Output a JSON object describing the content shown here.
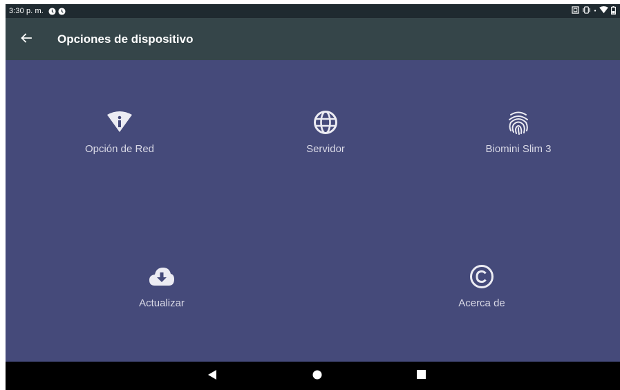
{
  "status_bar": {
    "time": "3:30 p. m.",
    "left_icons": [
      "clock-icon",
      "clock-icon"
    ],
    "right_icons": [
      "screenshot-icon",
      "vibrate-icon",
      "wifi-icon",
      "battery-icon"
    ]
  },
  "app_bar": {
    "back_icon": "arrow-left-icon",
    "title": "Opciones de dispositivo",
    "color": "#354549"
  },
  "content": {
    "background": "#454a7a",
    "tiles": [
      {
        "id": "network",
        "label": "Opción de Red",
        "icon": "wifi-info-icon"
      },
      {
        "id": "server",
        "label": "Servidor",
        "icon": "globe-icon"
      },
      {
        "id": "biomini",
        "label": "Biomini Slim 3",
        "icon": "fingerprint-icon"
      },
      {
        "id": "update",
        "label": "Actualizar",
        "icon": "cloud-download-icon"
      },
      {
        "id": "about",
        "label": "Acerca de",
        "icon": "copyright-icon"
      }
    ]
  },
  "nav_bar": {
    "buttons": [
      "back-triangle-icon",
      "home-circle-icon",
      "recents-square-icon"
    ]
  }
}
